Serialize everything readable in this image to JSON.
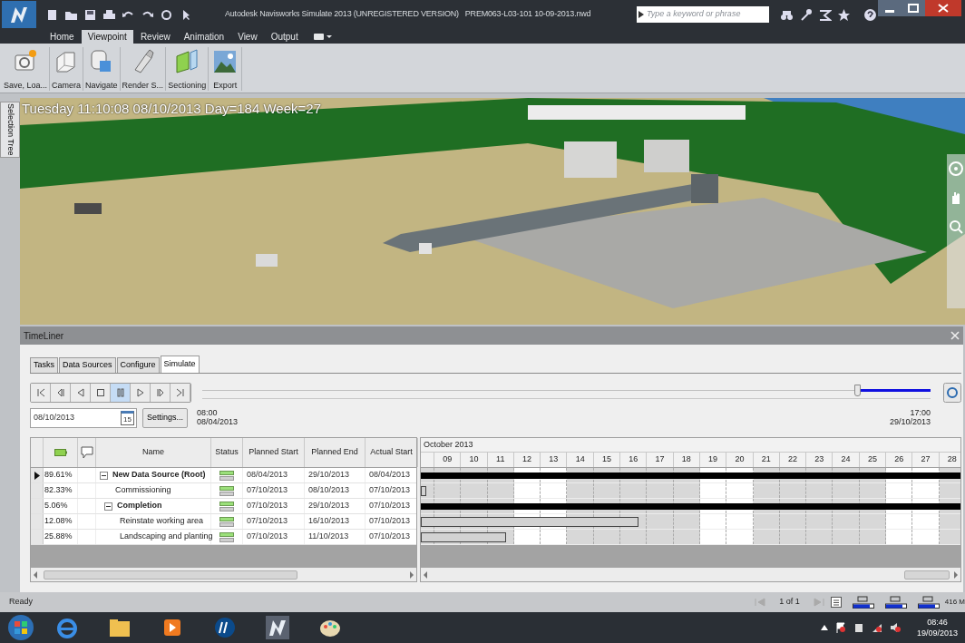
{
  "window": {
    "title": "Autodesk Navisworks Simulate 2013 (UNREGISTERED VERSION)   PREM063-L03-101 10-09-2013.nwd"
  },
  "search": {
    "placeholder": "Type a keyword or phrase"
  },
  "ribbon_tabs": [
    {
      "label": "Home",
      "selected": false
    },
    {
      "label": "Viewpoint",
      "selected": true
    },
    {
      "label": "Review",
      "selected": false
    },
    {
      "label": "Animation",
      "selected": false
    },
    {
      "label": "View",
      "selected": false
    },
    {
      "label": "Output",
      "selected": false
    }
  ],
  "ribbon_buttons": [
    {
      "label": "Save, Loa...",
      "kind": "save"
    },
    {
      "label": "Camera",
      "kind": "camera"
    },
    {
      "label": "Navigate",
      "kind": "navigate"
    },
    {
      "label": "Render S...",
      "kind": "render"
    },
    {
      "label": "Sectioning",
      "kind": "sectioning"
    },
    {
      "label": "Export",
      "kind": "export"
    }
  ],
  "side_panel": {
    "label": "Selection Tree"
  },
  "viewport": {
    "kind": "picture",
    "overlay": "Tuesday 11:10:08 08/10/2013 Day=184 Week=27"
  },
  "timeliner": {
    "title": "TimeLiner",
    "tabs": [
      {
        "label": "Tasks",
        "selected": false
      },
      {
        "label": "Data Sources",
        "selected": false
      },
      {
        "label": "Configure",
        "selected": false
      },
      {
        "label": "Simulate",
        "selected": true
      }
    ],
    "playback": [
      {
        "kind": "first",
        "selected": false
      },
      {
        "kind": "step-back",
        "selected": false
      },
      {
        "kind": "reverse",
        "selected": false
      },
      {
        "kind": "stop",
        "selected": false
      },
      {
        "kind": "pause",
        "selected": true
      },
      {
        "kind": "play",
        "selected": false
      },
      {
        "kind": "step-forward",
        "selected": false
      },
      {
        "kind": "last",
        "selected": false
      }
    ],
    "slider": {
      "level": 0.9
    },
    "date_field": {
      "value": "08/10/2013",
      "calendar_day": "15"
    },
    "settings_button": "Settings...",
    "start": {
      "time": "08:00",
      "date": "08/04/2013"
    },
    "end": {
      "time": "17:00",
      "date": "29/10/2013"
    },
    "table": {
      "columns": [
        {
          "kind": "progress"
        },
        {
          "kind": "comment"
        },
        {
          "kind": "text",
          "label": "Name"
        },
        {
          "kind": "text",
          "label": "Status"
        },
        {
          "kind": "text",
          "label": "Planned Start"
        },
        {
          "kind": "text",
          "label": "Planned End"
        },
        {
          "kind": "text",
          "label": "Actual Start"
        }
      ],
      "rows": [
        {
          "progress": "89.61%",
          "name": "New Data Source (Root)",
          "planned_start": "08/04/2013",
          "planned_end": "29/10/2013",
          "actual_start": "08/04/2013",
          "selected": true,
          "expanded": true,
          "children": [
            {
              "progress": "82.33%",
              "name": "Commissioning",
              "planned_start": "07/10/2013",
              "planned_end": "08/10/2013",
              "actual_start": "07/10/2013",
              "selected": false
            },
            {
              "progress": "5.06%",
              "name": "Completion",
              "planned_start": "07/10/2013",
              "planned_end": "29/10/2013",
              "actual_start": "07/10/2013",
              "selected": false,
              "expanded": true,
              "children": [
                {
                  "progress": "12.08%",
                  "name": "Reinstate working area",
                  "planned_start": "07/10/2013",
                  "planned_end": "16/10/2013",
                  "actual_start": "07/10/2013",
                  "selected": false
                },
                {
                  "progress": "25.88%",
                  "name": "Landscaping and planting",
                  "planned_start": "07/10/2013",
                  "planned_end": "11/10/2013",
                  "actual_start": "07/10/2013",
                  "selected": false
                }
              ]
            }
          ]
        }
      ]
    },
    "gantt": {
      "month": "October 2013",
      "days": [
        "09",
        "10",
        "11",
        "12",
        "13",
        "14",
        "15",
        "16",
        "17",
        "18",
        "19",
        "20",
        "21",
        "22",
        "23",
        "24",
        "25",
        "26",
        "27",
        "28"
      ]
    }
  },
  "status_bar": {
    "text": "Ready",
    "page": "1 of 1",
    "memory": "416 M"
  },
  "taskbar": {
    "time": "08:46",
    "date": "19/09/2013"
  }
}
